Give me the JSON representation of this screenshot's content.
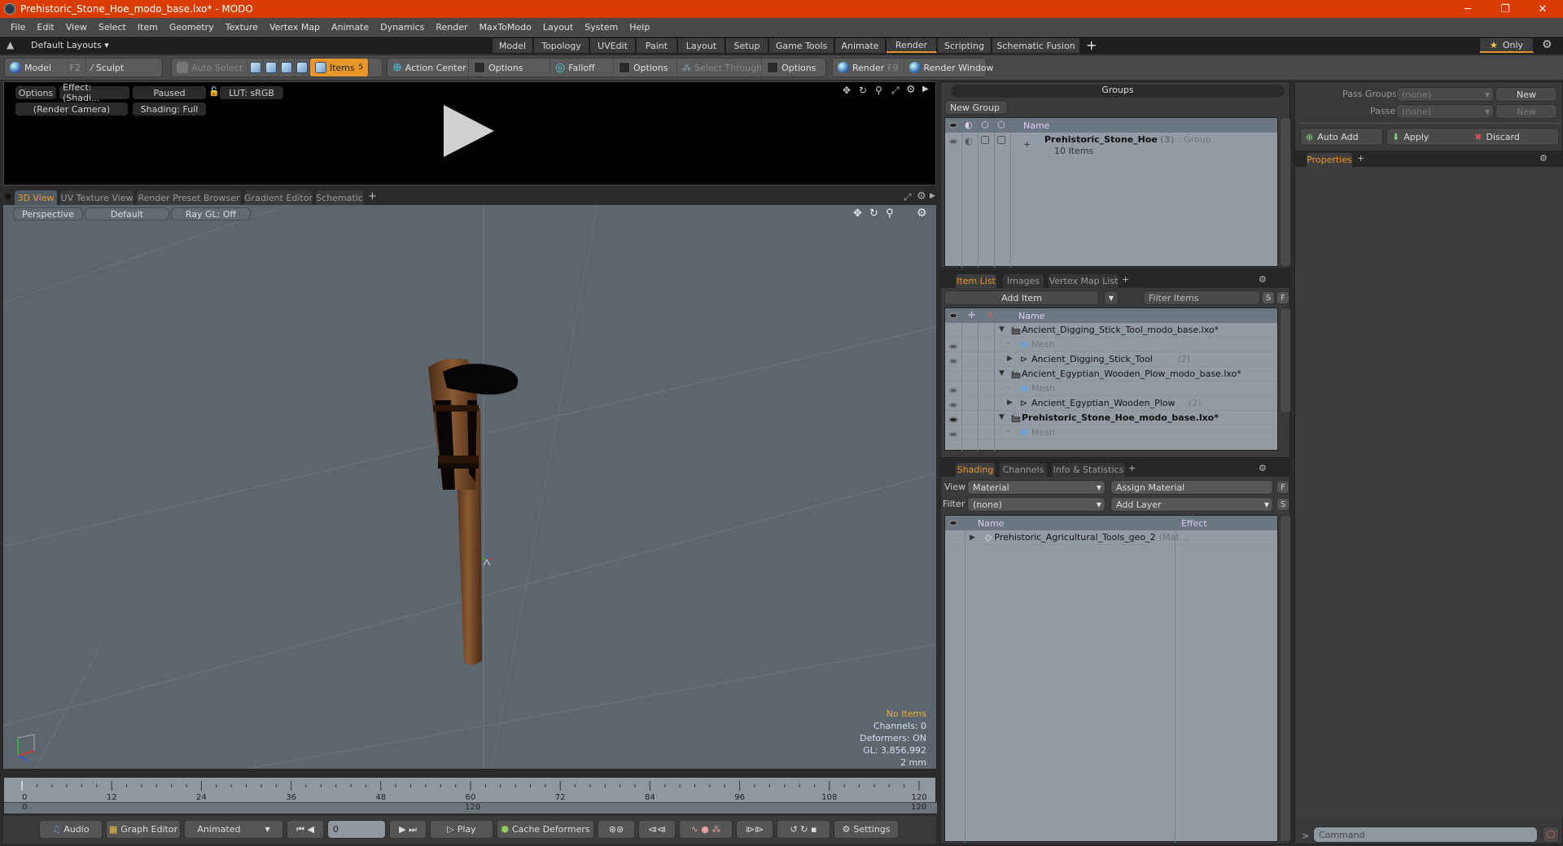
{
  "window": {
    "title": "Prehistoric_Stone_Hoe_modo_base.lxo* - MODO",
    "controls": {
      "minimize": "─",
      "restore": "❐",
      "close": "✕"
    }
  },
  "menu": [
    "File",
    "Edit",
    "View",
    "Select",
    "Item",
    "Geometry",
    "Texture",
    "Vertex Map",
    "Animate",
    "Dynamics",
    "Render",
    "MaxToModo",
    "Layout",
    "System",
    "Help"
  ],
  "layouts": {
    "dropdown": "Default Layouts ▾",
    "tabs": [
      "Model",
      "Topology",
      "UVEdit",
      "Paint",
      "Layout",
      "Setup",
      "Game Tools",
      "Animate",
      "Render",
      "Scripting",
      "Schematic Fusion"
    ],
    "active_tab": "Render",
    "add": "+",
    "only": "Only",
    "star": "★",
    "gear": "⚙"
  },
  "toolbar": {
    "model": "Model",
    "model_key": "F2",
    "sculpt": "Sculpt",
    "auto_select": "Auto Select",
    "items": "Items",
    "items_count": "5",
    "action_center": "Action Center",
    "options1": "Options",
    "falloff": "Falloff",
    "options2": "Options",
    "select_through": "Select Through",
    "options3": "Options",
    "render": "Render",
    "render_key": "F9",
    "render_window": "Render Window"
  },
  "preview": {
    "options": "Options",
    "effect": "Effect: (Shadi...",
    "paused": "Paused",
    "lut": "LUT: sRGB",
    "camera": "(Render Camera)",
    "shading": "Shading: Full"
  },
  "viewport_tabs": {
    "tabs": [
      "3D View",
      "UV Texture View",
      "Render Preset Browser",
      "Gradient Editor",
      "Schematic"
    ],
    "active": "3D View",
    "add": "+"
  },
  "viewport": {
    "perspective": "Perspective",
    "default": "Default",
    "raygl": "Ray GL: Off",
    "stats": {
      "no_items": "No Items",
      "channels": "Channels: 0",
      "deformers": "Deformers: ON",
      "gl": "GL: 3,856,992",
      "unit": "2 mm"
    },
    "colors": {
      "background": "#5c666e",
      "stats_highlight": "#e8b030"
    }
  },
  "timeline": {
    "ticks": [
      "0",
      "12",
      "24",
      "36",
      "48",
      "60",
      "72",
      "84",
      "96",
      "108",
      "120"
    ],
    "range_start": "0",
    "range_mid": "120",
    "range_end": "120"
  },
  "bottom": {
    "audio": "Audio",
    "graph_editor": "Graph Editor",
    "animated": "Animated",
    "frame": "0",
    "play": "Play",
    "cache_deformers": "Cache Deformers",
    "settings": "Settings"
  },
  "groups": {
    "title": "Groups",
    "new_group": "New Group",
    "col_name": "Name",
    "rows": [
      {
        "name": "Prehistoric_Stone_Hoe",
        "count": "(3)",
        "type": ": Group",
        "sub": "10 Items"
      }
    ]
  },
  "passes": {
    "pass_groups_label": "Pass Groups",
    "pass_groups_value": "(none)",
    "passes_label": "Passes",
    "passes_value": "(none)",
    "new1": "New",
    "new2": "New",
    "auto_add": "Auto Add",
    "apply": "Apply",
    "discard": "Discard"
  },
  "properties": {
    "tab": "Properties",
    "add": "+"
  },
  "item_list": {
    "tabs": [
      "Item List",
      "Images",
      "Vertex Map List"
    ],
    "active": "Item List",
    "add_item": "Add Item",
    "filter_placeholder": "Filter Items",
    "s": "S",
    "f": "F",
    "col_name": "Name",
    "rows": [
      {
        "label": "Ancient_Digging_Stick_Tool_modo_base.lxo*",
        "kind": "scene",
        "indent": 0,
        "bold": false,
        "eye": false
      },
      {
        "label": "Mesh",
        "kind": "mesh",
        "indent": 1,
        "bold": false,
        "eye": true
      },
      {
        "label": "Ancient_Digging_Stick_Tool",
        "count": "(2)",
        "kind": "group",
        "indent": 1,
        "bold": false,
        "eye": true
      },
      {
        "label": "Ancient_Egyptian_Wooden_Plow_modo_base.lxo*",
        "kind": "scene",
        "indent": 0,
        "bold": false,
        "eye": false
      },
      {
        "label": "Mesh",
        "kind": "mesh",
        "indent": 1,
        "bold": false,
        "eye": true
      },
      {
        "label": "Ancient_Egyptian_Wooden_Plow",
        "count": "(2)",
        "kind": "group",
        "indent": 1,
        "bold": false,
        "eye": true
      },
      {
        "label": "Prehistoric_Stone_Hoe_modo_base.lxo*",
        "kind": "scene",
        "indent": 0,
        "bold": true,
        "eye": true
      },
      {
        "label": "Mesh",
        "kind": "mesh",
        "indent": 1,
        "bold": false,
        "eye": true
      }
    ]
  },
  "shading": {
    "tabs": [
      "Shading",
      "Channels",
      "Info & Statistics"
    ],
    "active": "Shading",
    "view_label": "View",
    "view_value": "Material",
    "assign_material": "Assign Material",
    "filter_label": "Filter",
    "filter_value": "(none)",
    "add_layer": "Add Layer",
    "f": "F",
    "s": "S",
    "col_name": "Name",
    "col_effect": "Effect",
    "rows": [
      {
        "name": "Prehistoric_Agricultural_Tools_geo_2",
        "suffix": "(Mat..."
      }
    ]
  },
  "command": {
    "prompt": ">",
    "placeholder": "Command"
  },
  "theme": {
    "title_bg": "#da3b01",
    "accent": "#e8962a"
  }
}
